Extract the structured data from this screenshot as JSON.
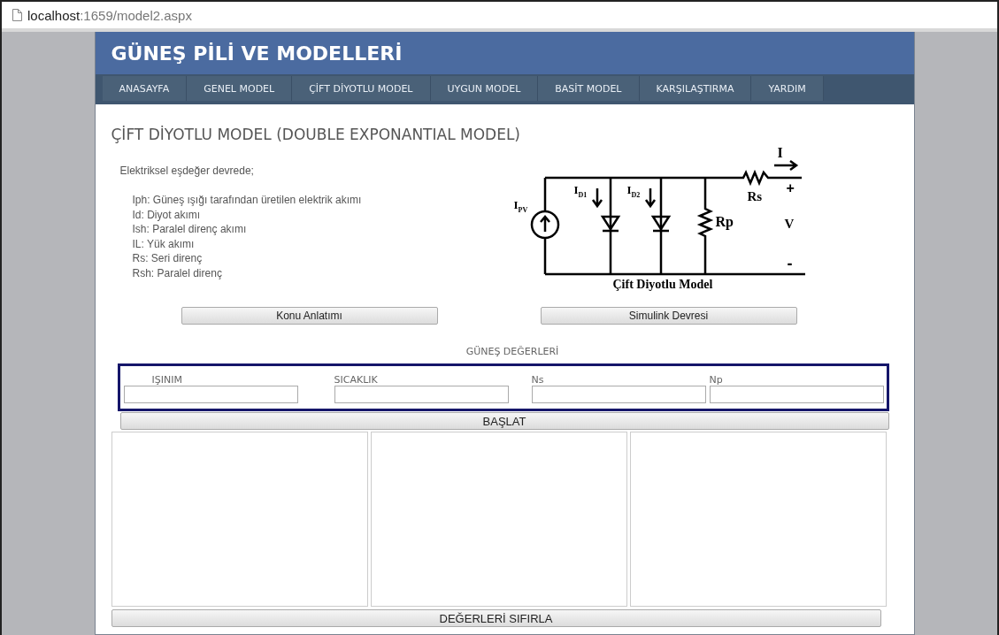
{
  "browser": {
    "url_host": "localhost",
    "url_path": ":1659/model2.aspx"
  },
  "header": {
    "title": "GÜNEŞ PİLİ VE MODELLERİ"
  },
  "nav": [
    {
      "label": "ANASAYFA",
      "selected": false
    },
    {
      "label": "GENEL MODEL",
      "selected": false
    },
    {
      "label": "ÇİFT DİYOTLU MODEL",
      "selected": false
    },
    {
      "label": "UYGUN MODEL",
      "selected": false
    },
    {
      "label": "BASİT MODEL",
      "selected": false
    },
    {
      "label": "KARŞILAŞTIRMA",
      "selected": false
    },
    {
      "label": "YARDIM",
      "selected": false
    }
  ],
  "heading": "ÇİFT DİYOTLU MODEL (DOUBLE EXPONANTIAL MODEL)",
  "intro": "Elektriksel eşdeğer devrede;",
  "definitions": [
    "Iph: Güneş ışığı tarafından üretilen elektrik akımı",
    "Id: Diyot akımı",
    "Ish: Paralel direnç akımı",
    "IL: Yük akımı",
    "Rs: Seri direnç",
    "Rsh: Paralel direnç"
  ],
  "circuit": {
    "source_label": "I$_{PV}$",
    "diode1_label": "I$_{D1}$",
    "diode2_label": "I$_{D2}$",
    "shunt_label": "Rp",
    "series_label": "Rs",
    "current_label": "I",
    "plus": "+",
    "voltage": "V",
    "minus": "-",
    "caption": "Çift Diyotlu Model"
  },
  "buttons": {
    "lecture": "Konu Anlatımı",
    "simulink": "Simulink Devresi",
    "start": "BAŞLAT",
    "reset": "DEĞERLERİ SIFIRLA"
  },
  "inputs_title": "GÜNEŞ DEĞERLERİ",
  "fields": [
    {
      "label": "IŞINIM"
    },
    {
      "label": "SICAKLIK"
    },
    {
      "label": "Ns"
    },
    {
      "label": "Np"
    }
  ]
}
